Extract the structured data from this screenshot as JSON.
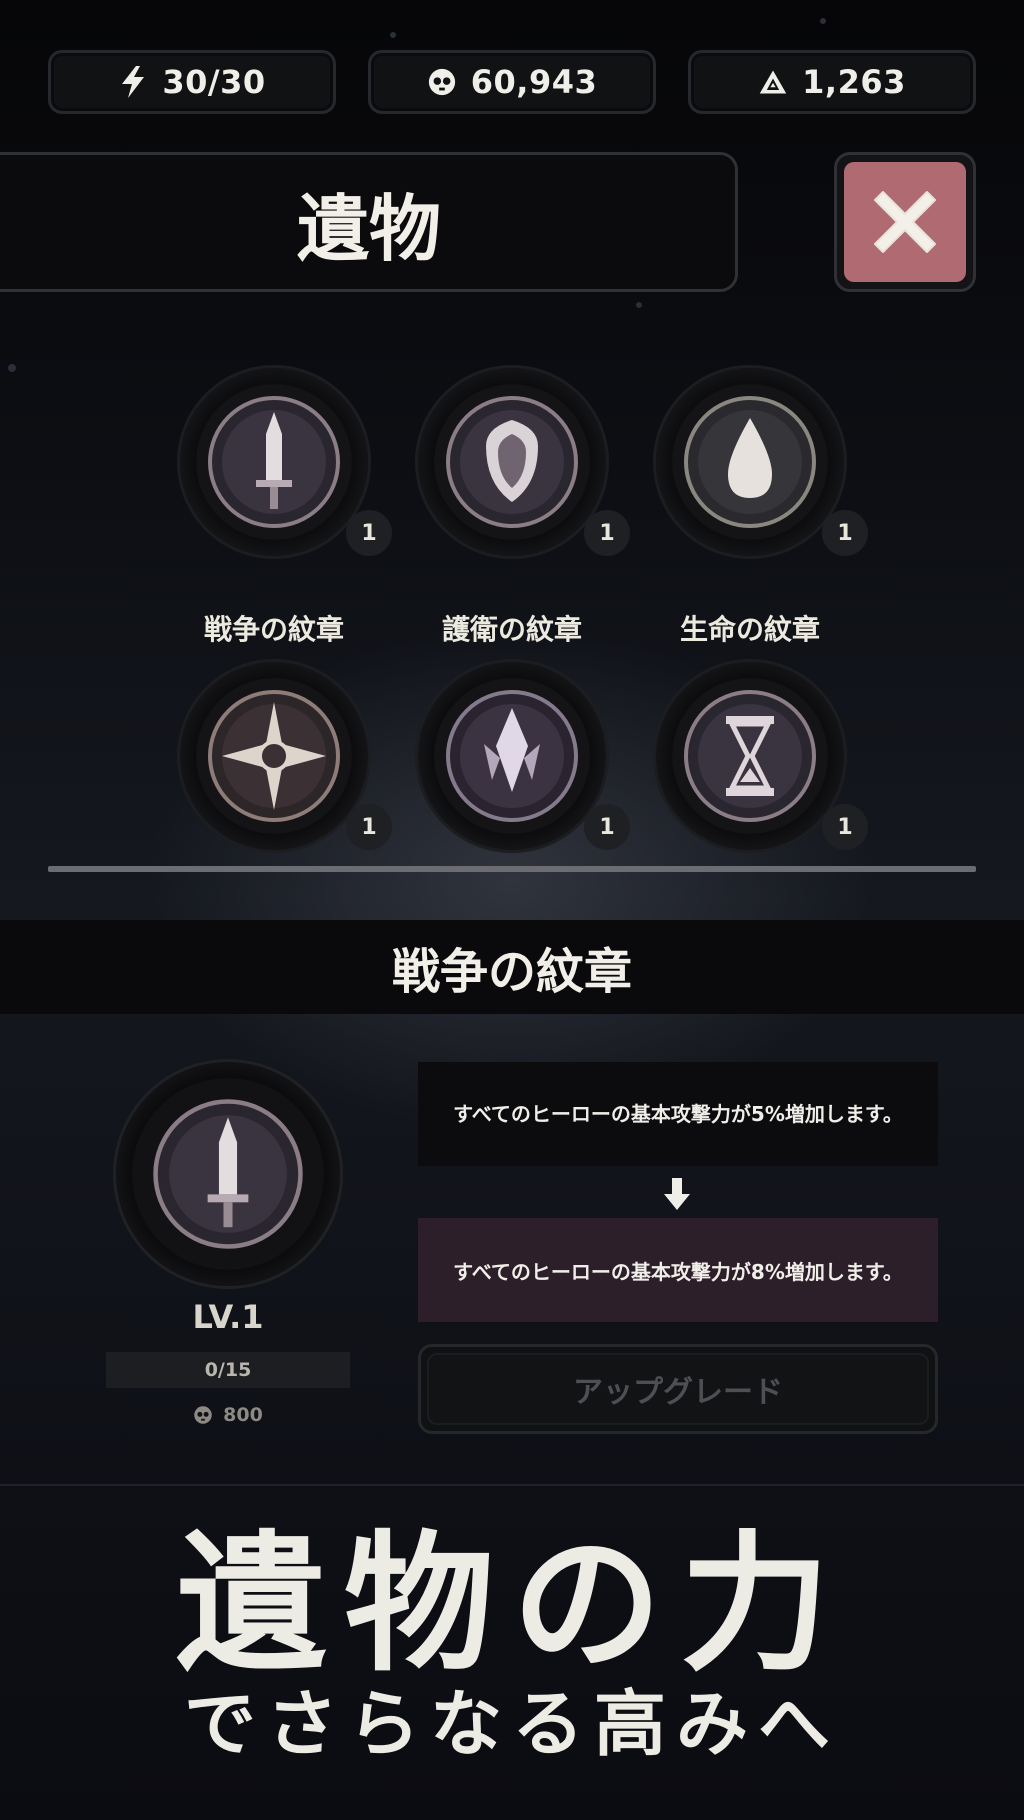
{
  "currencies": [
    {
      "icon": "energy-bolt-icon",
      "value": "30/30"
    },
    {
      "icon": "skull-coin-icon",
      "value": "60,943"
    },
    {
      "icon": "triangle-crystal-icon",
      "value": "1,263"
    }
  ],
  "header": {
    "title": "遺物",
    "close_icon": "close-x-icon"
  },
  "relics": [
    {
      "name": "戦争の紋章",
      "count": "1",
      "icon": "sword-emblem-icon"
    },
    {
      "name": "護衛の紋章",
      "count": "1",
      "icon": "shield-emblem-icon"
    },
    {
      "name": "生命の紋章",
      "count": "1",
      "icon": "droplet-emblem-icon"
    },
    {
      "name": "",
      "count": "1",
      "icon": "star-compass-emblem-icon"
    },
    {
      "name": "",
      "count": "1",
      "icon": "crystal-emblem-icon"
    },
    {
      "name": "",
      "count": "1",
      "icon": "hourglass-emblem-icon"
    }
  ],
  "selected": {
    "name": "戦争の紋章",
    "level": "LV.1",
    "progress": "0/15",
    "cost": "800",
    "current_effect": "すべてのヒーローの基本攻撃力が5%増加します。",
    "next_effect": "すべてのヒーローの基本攻撃力が8%増加します。",
    "upgrade_label": "アップグレード"
  },
  "promo": {
    "line1": "遺物の力",
    "line2": "でさらなる高みへ"
  },
  "colors": {
    "close_button": "#b06b72",
    "next_effect_bg": "#2d1f29",
    "background": "#0b0c10"
  }
}
